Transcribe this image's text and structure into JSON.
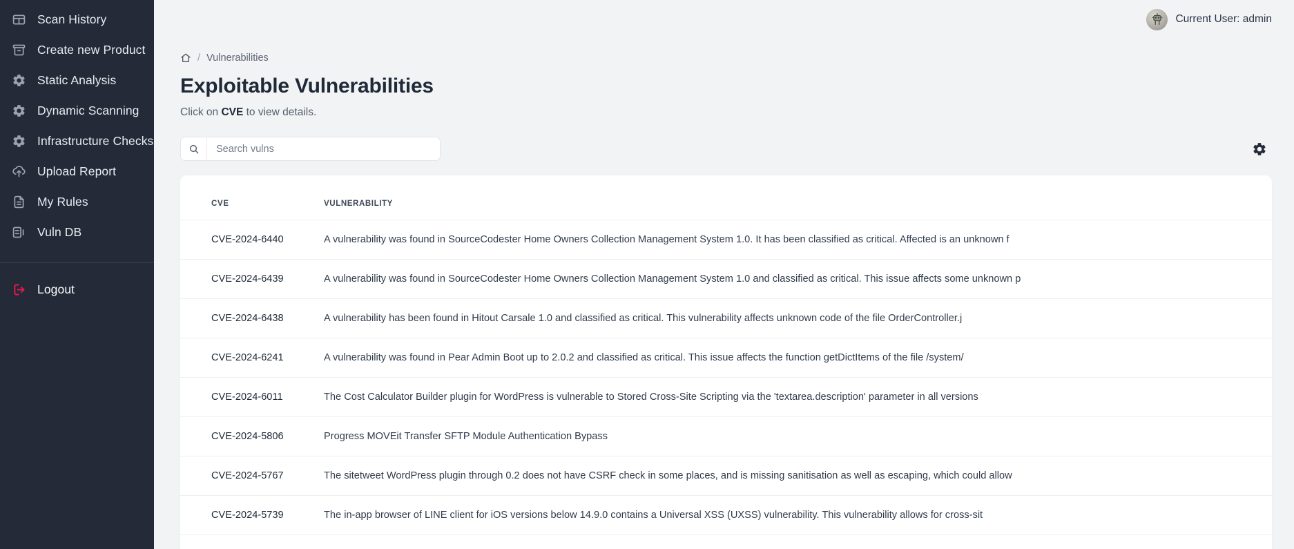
{
  "sidebar": {
    "items": [
      {
        "label": "Scan History",
        "icon": "table-icon"
      },
      {
        "label": "Create new Product",
        "icon": "archive-box-icon"
      },
      {
        "label": "Static Analysis",
        "icon": "gear-icon"
      },
      {
        "label": "Dynamic Scanning",
        "icon": "gear-icon"
      },
      {
        "label": "Infrastructure Checks",
        "icon": "gear-icon"
      },
      {
        "label": "Upload Report",
        "icon": "upload-cloud-icon"
      },
      {
        "label": "My Rules",
        "icon": "document-icon"
      },
      {
        "label": "Vuln DB",
        "icon": "database-icon"
      }
    ],
    "logout": {
      "label": "Logout",
      "icon": "logout-icon",
      "color": "#e8184c"
    },
    "background": "#242a38"
  },
  "topbar": {
    "user_label": "Current User: admin",
    "avatar_icon": "robot-avatar"
  },
  "breadcrumb": {
    "home_icon": "home-icon",
    "separator": "/",
    "current": "Vulnerabilities"
  },
  "page": {
    "title": "Exploitable Vulnerabilities",
    "subtitle_pre": "Click on ",
    "subtitle_bold": "CVE",
    "subtitle_post": " to view details."
  },
  "search": {
    "icon": "search-icon",
    "placeholder": "Search vulns",
    "value": ""
  },
  "settings": {
    "icon": "gear-icon",
    "label": "Settings"
  },
  "table": {
    "columns": [
      "CVE",
      "VULNERABILITY"
    ],
    "rows": [
      {
        "cve": "CVE-2024-6440",
        "vulnerability": "A vulnerability was found in SourceCodester Home Owners Collection Management System 1.0. It has been classified as critical. Affected is an unknown f"
      },
      {
        "cve": "CVE-2024-6439",
        "vulnerability": "A vulnerability was found in SourceCodester Home Owners Collection Management System 1.0 and classified as critical. This issue affects some unknown p"
      },
      {
        "cve": "CVE-2024-6438",
        "vulnerability": "A vulnerability has been found in Hitout Carsale 1.0 and classified as critical. This vulnerability affects unknown code of the file OrderController.j"
      },
      {
        "cve": "CVE-2024-6241",
        "vulnerability": "A vulnerability was found in Pear Admin Boot up to 2.0.2 and classified as critical. This issue affects the function getDictItems of the file /system/"
      },
      {
        "cve": "CVE-2024-6011",
        "vulnerability": "The Cost Calculator Builder plugin for WordPress is vulnerable to Stored Cross-Site Scripting via the 'textarea.description' parameter in all versions"
      },
      {
        "cve": "CVE-2024-5806",
        "vulnerability": "Progress MOVEit Transfer SFTP Module Authentication Bypass"
      },
      {
        "cve": "CVE-2024-5767",
        "vulnerability": "The sitetweet WordPress plugin through 0.2 does not have CSRF check in some places, and is missing sanitisation as well as escaping, which could allow"
      },
      {
        "cve": "CVE-2024-5739",
        "vulnerability": "The in-app browser of LINE client for iOS versions below 14.9.0 contains a Universal XSS (UXSS) vulnerability. This vulnerability allows for cross-sit"
      }
    ]
  }
}
